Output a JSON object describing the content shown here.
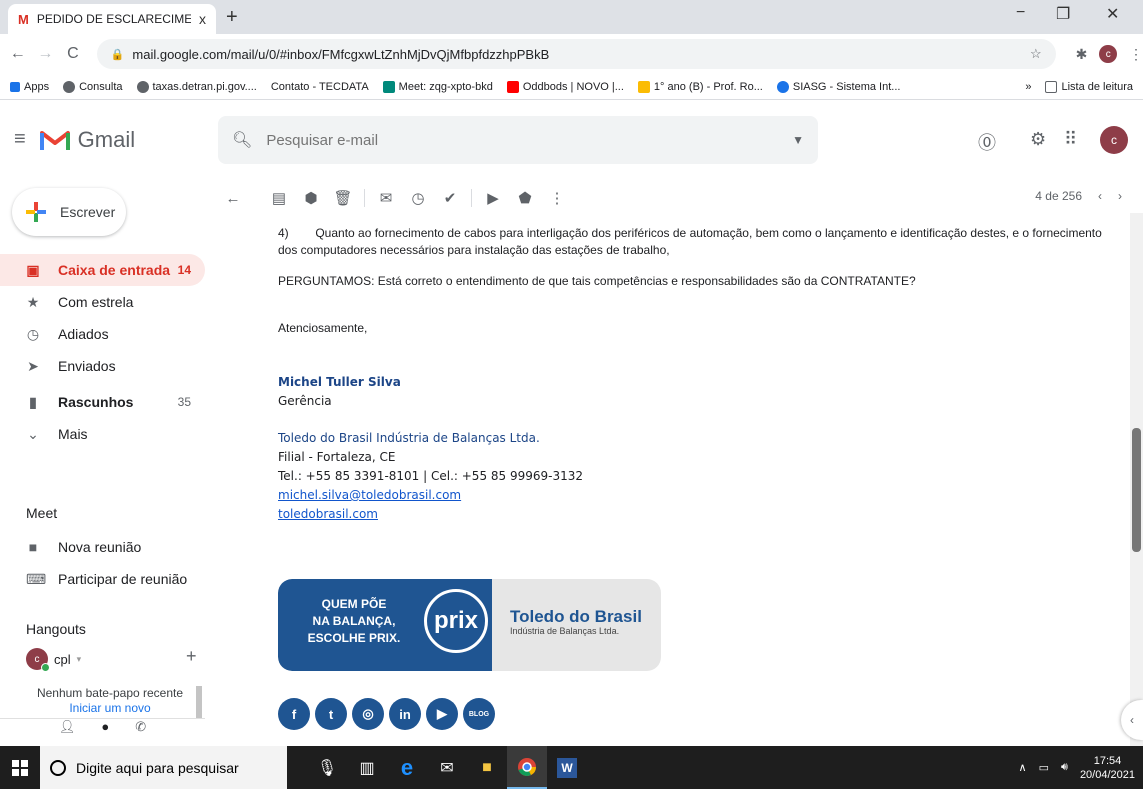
{
  "browser": {
    "tab_title": "PEDIDO DE ESCLARECIMENTOS",
    "tab_close": "x",
    "new_tab": "+",
    "url": "mail.google.com/mail/u/0/#inbox/FMfcgxwLtZnhMjDvQjMfbpfdzzhpPBkB",
    "window_controls": [
      "−",
      "❐",
      "✕"
    ],
    "profile_initial": "c",
    "bookmarks": [
      {
        "label": "Apps",
        "color": "#1a73e8"
      },
      {
        "label": "Consulta",
        "color": "#5f6368"
      },
      {
        "label": "taxas.detran.pi.gov....",
        "color": "#5f6368"
      },
      {
        "label": "Contato - TECDATA",
        "color": "#ffffff"
      },
      {
        "label": "Meet: zqg-xpto-bkd",
        "color": "#00897b"
      },
      {
        "label": "Oddbods | NOVO |...",
        "color": "#ff0000"
      },
      {
        "label": "1° ano (B) - Prof. Ro...",
        "color": "#fbbc04"
      },
      {
        "label": "SIASG - Sistema Int...",
        "color": "#1a73e8"
      }
    ],
    "more_bookmarks": "»",
    "reading_list": "Lista de leitura"
  },
  "gmail": {
    "logo_text": "Gmail",
    "search_placeholder": "Pesquisar e-mail",
    "avatar_initial": "c",
    "compose_label": "Escrever",
    "nav": [
      {
        "label": "Caixa de entrada",
        "count": "14",
        "icon": "inbox-icon",
        "active": true
      },
      {
        "label": "Com estrela",
        "count": "",
        "icon": "star-icon"
      },
      {
        "label": "Adiados",
        "count": "",
        "icon": "clock-icon"
      },
      {
        "label": "Enviados",
        "count": "",
        "icon": "send-icon"
      },
      {
        "label": "Rascunhos",
        "count": "35",
        "icon": "draft-icon",
        "bold": true
      },
      {
        "label": "Mais",
        "count": "",
        "icon": "chevron-down-icon"
      }
    ],
    "meet": {
      "header": "Meet",
      "items": [
        "Nova reunião",
        "Participar de reunião"
      ]
    },
    "hangouts": {
      "header": "Hangouts",
      "user": "cpl",
      "user_initial": "c",
      "add": "+",
      "no_chat": "Nenhum bate-papo recente",
      "start_new": "Iniciar um novo"
    },
    "pager": {
      "position": "4 de 256"
    }
  },
  "message": {
    "p1": "4)        Quanto ao fornecimento de cabos para interligação dos periféricos de automação, bem como o lançamento e identificação destes, e o fornecimento dos computadores necessários para instalação das estações de trabalho,",
    "p2": "PERGUNTAMOS: Está correto o entendimento de que tais competências e responsabilidades são da CONTRATANTE?",
    "closing": "Atenciosamente,",
    "sig_name": "Michel Tuller Silva",
    "sig_role": "Gerência",
    "sig_company": "Toledo do Brasil Indústria de Balanças Ltda.",
    "sig_branch": "Filial - Fortaleza, CE",
    "sig_phone": "Tel.: +55 85 3391-8101 | Cel.: +55 85 99969-3132",
    "sig_email": "michel.silva@toledobrasil.com",
    "sig_site": "toledobrasil.com",
    "banner_slogan_1": "QUEM PÕE",
    "banner_slogan_2": "NA BALANÇA,",
    "banner_slogan_3": "ESCOLHE PRIX.",
    "banner_prix": "prix",
    "banner_brand": "Toledo do Brasil",
    "banner_sub": "Indústria de Balanças Ltda.",
    "blog": "BLOG"
  },
  "taskbar": {
    "search_placeholder": "Digite aqui para pesquisar",
    "time": "17:54",
    "date": "20/04/2021"
  },
  "colors": {
    "gmail_red": "#d93025",
    "toledo_blue": "#1f5592",
    "link_blue": "#1155cc"
  }
}
